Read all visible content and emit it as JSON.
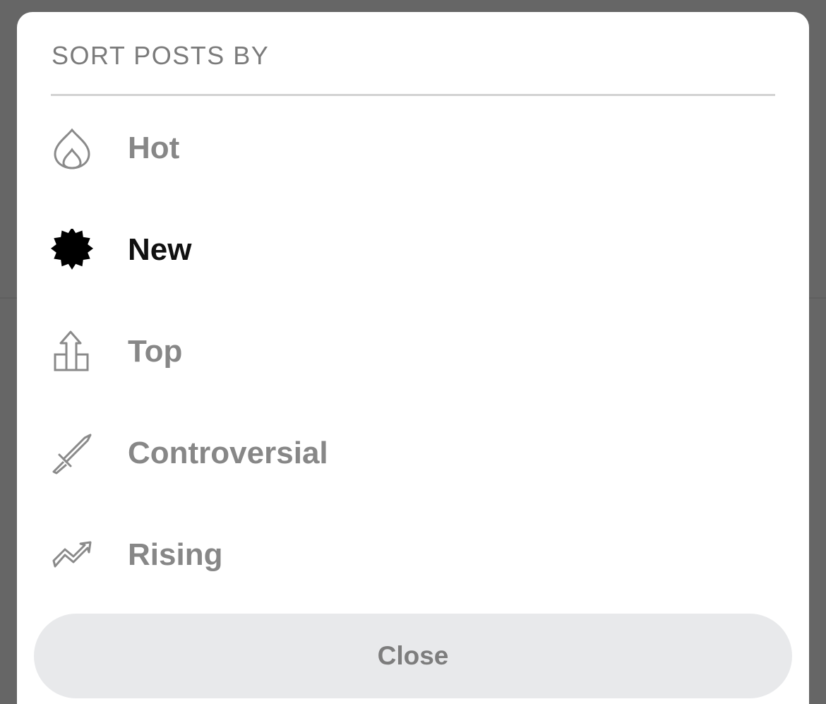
{
  "sheet": {
    "title": "SORT POSTS BY",
    "selected": "new",
    "options": [
      {
        "id": "hot",
        "label": "Hot",
        "icon": "flame-icon"
      },
      {
        "id": "new",
        "label": "New",
        "icon": "starburst-icon"
      },
      {
        "id": "top",
        "label": "Top",
        "icon": "top-bars-arrow-icon"
      },
      {
        "id": "controversial",
        "label": "Controversial",
        "icon": "sword-icon"
      },
      {
        "id": "rising",
        "label": "Rising",
        "icon": "trending-up-icon"
      }
    ],
    "close_label": "Close"
  },
  "colors": {
    "backdrop": "#666666",
    "sheet_background": "#ffffff",
    "inactive_text": "#878787",
    "active_text": "#111111",
    "close_button_background": "#e8e9eb"
  }
}
